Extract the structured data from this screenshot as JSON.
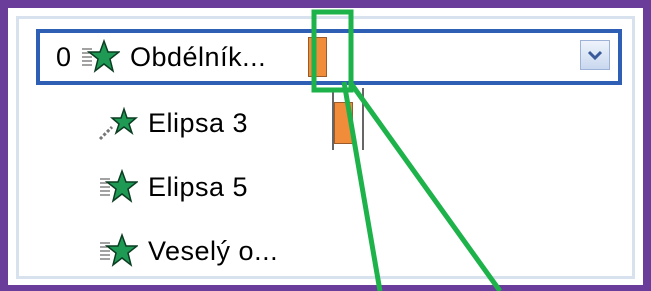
{
  "animation_pane": {
    "items": [
      {
        "order": "0",
        "label": "Obdélník...",
        "selected": true,
        "icon": "entrance-effect-star-icon"
      },
      {
        "order": "",
        "label": "Elipsa 3",
        "selected": false,
        "icon": "motion-path-star-icon"
      },
      {
        "order": "",
        "label": "Elipsa 5",
        "selected": false,
        "icon": "entrance-effect-star-icon"
      },
      {
        "order": "",
        "label": "Veselý o...",
        "selected": false,
        "icon": "entrance-effect-star-icon"
      }
    ],
    "dropdown_icon": "chevron-down-icon"
  },
  "colors": {
    "window_border": "#6a3d9a",
    "selection_border": "#2f5fb5",
    "timeline_bar": "#f08c3a",
    "annotation": "#1db24a"
  }
}
